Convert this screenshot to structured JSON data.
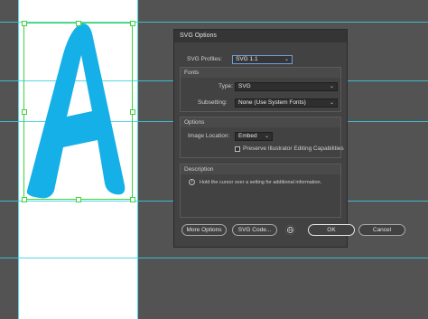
{
  "dialog": {
    "title": "SVG Options",
    "svg_profiles_label": "SVG Profiles:",
    "svg_profiles_value": "SVG 1.1",
    "fonts_header": "Fonts",
    "type_label": "Type:",
    "type_value": "SVG",
    "subsetting_label": "Subsetting:",
    "subsetting_value": "None (Use System Fonts)",
    "options_header": "Options",
    "image_location_label": "Image Location:",
    "image_location_value": "Embed",
    "preserve_label": "Preserve Illustrator Editing Capabilities",
    "preserve_checked": false,
    "description_header": "Description",
    "description_text": "Hold the cursor over a setting for additional information.",
    "more_options_label": "More Options",
    "svg_code_label": "SVG Code...",
    "ok_label": "OK",
    "cancel_label": "Cancel"
  },
  "canvas": {
    "artwork_letter": "A",
    "artwork_color": "#16b0e8",
    "guide_color": "#36d0e0",
    "selection_color": "#3cd33c"
  }
}
